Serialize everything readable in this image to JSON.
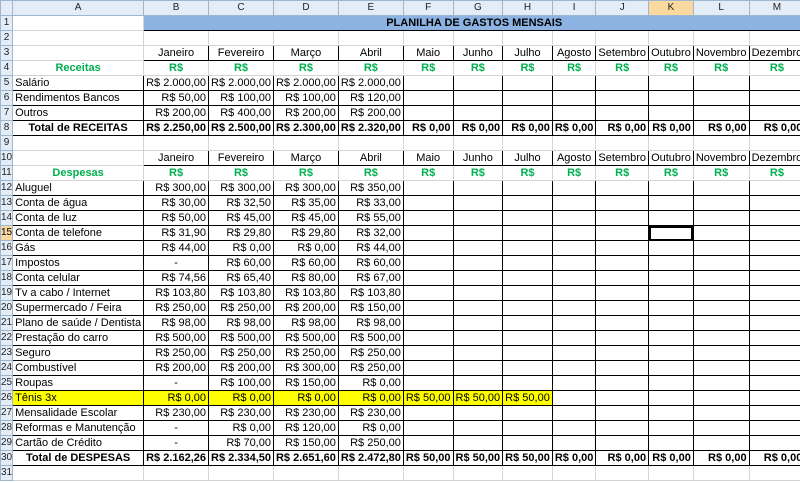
{
  "columns": [
    "",
    "A",
    "B",
    "C",
    "D",
    "E",
    "F",
    "G",
    "H",
    "I",
    "J",
    "K",
    "L",
    "M"
  ],
  "selected_column": "K",
  "selected_row": "15",
  "title": "PLANILHA DE GASTOS MENSAIS",
  "months": [
    "Janeiro",
    "Fevereiro",
    "Março",
    "Abril",
    "Maio",
    "Junho",
    "Julho",
    "Agosto",
    "Setembro",
    "Outubro",
    "Novembro",
    "Dezembro"
  ],
  "currency": "R$",
  "receitas_label": "Receitas",
  "despesas_label": "Despesas",
  "receitas": [
    {
      "row": "5",
      "label": "Salário",
      "values": [
        "R$ 2.000,00",
        "R$ 2.000,00",
        "R$ 2.000,00",
        "R$ 2.000,00",
        "",
        "",
        "",
        "",
        "",
        "",
        "",
        ""
      ]
    },
    {
      "row": "6",
      "label": "Rendimentos Bancos",
      "values": [
        "R$ 50,00",
        "R$ 100,00",
        "R$ 100,00",
        "R$ 120,00",
        "",
        "",
        "",
        "",
        "",
        "",
        "",
        ""
      ]
    },
    {
      "row": "7",
      "label": "Outros",
      "values": [
        "R$ 200,00",
        "R$ 400,00",
        "R$ 200,00",
        "R$ 200,00",
        "",
        "",
        "",
        "",
        "",
        "",
        "",
        ""
      ]
    }
  ],
  "total_receitas": {
    "row": "8",
    "label": "Total de RECEITAS",
    "values": [
      "R$ 2.250,00",
      "R$ 2.500,00",
      "R$ 2.300,00",
      "R$ 2.320,00",
      "R$ 0,00",
      "R$ 0,00",
      "R$ 0,00",
      "R$ 0,00",
      "R$ 0,00",
      "R$ 0,00",
      "R$ 0,00",
      "R$ 0,00"
    ]
  },
  "despesas": [
    {
      "row": "12",
      "label": "Aluguel",
      "values": [
        "R$ 300,00",
        "R$ 300,00",
        "R$ 300,00",
        "R$ 350,00",
        "",
        "",
        "",
        "",
        "",
        "",
        "",
        ""
      ]
    },
    {
      "row": "13",
      "label": "Conta de água",
      "values": [
        "R$ 30,00",
        "R$ 32,50",
        "R$ 35,00",
        "R$ 33,00",
        "",
        "",
        "",
        "",
        "",
        "",
        "",
        ""
      ]
    },
    {
      "row": "14",
      "label": "Conta de luz",
      "values": [
        "R$ 50,00",
        "R$ 45,00",
        "R$ 45,00",
        "R$ 55,00",
        "",
        "",
        "",
        "",
        "",
        "",
        "",
        ""
      ]
    },
    {
      "row": "15",
      "label": "Conta de telefone",
      "values": [
        "R$ 31,90",
        "R$ 29,80",
        "R$ 29,80",
        "R$ 32,00",
        "",
        "",
        "",
        "",
        "",
        "",
        "",
        ""
      ]
    },
    {
      "row": "16",
      "label": "Gás",
      "values": [
        "R$ 44,00",
        "R$ 0,00",
        "R$ 0,00",
        "R$ 44,00",
        "",
        "",
        "",
        "",
        "",
        "",
        "",
        ""
      ]
    },
    {
      "row": "17",
      "label": "Impostos",
      "values": [
        "-",
        "R$ 60,00",
        "R$ 60,00",
        "R$ 60,00",
        "",
        "",
        "",
        "",
        "",
        "",
        "",
        ""
      ]
    },
    {
      "row": "18",
      "label": "Conta celular",
      "values": [
        "R$ 74,56",
        "R$ 65,40",
        "R$ 80,00",
        "R$ 67,00",
        "",
        "",
        "",
        "",
        "",
        "",
        "",
        ""
      ]
    },
    {
      "row": "19",
      "label": "Tv a cabo / Internet",
      "values": [
        "R$ 103,80",
        "R$ 103,80",
        "R$ 103,80",
        "R$ 103,80",
        "",
        "",
        "",
        "",
        "",
        "",
        "",
        ""
      ]
    },
    {
      "row": "20",
      "label": "Supermercado / Feira",
      "values": [
        "R$ 250,00",
        "R$ 250,00",
        "R$ 200,00",
        "R$ 150,00",
        "",
        "",
        "",
        "",
        "",
        "",
        "",
        ""
      ]
    },
    {
      "row": "21",
      "label": "Plano de saúde / Dentista",
      "values": [
        "R$ 98,00",
        "R$ 98,00",
        "R$ 98,00",
        "R$ 98,00",
        "",
        "",
        "",
        "",
        "",
        "",
        "",
        ""
      ]
    },
    {
      "row": "22",
      "label": "Prestação do carro",
      "values": [
        "R$ 500,00",
        "R$ 500,00",
        "R$ 500,00",
        "R$ 500,00",
        "",
        "",
        "",
        "",
        "",
        "",
        "",
        ""
      ]
    },
    {
      "row": "23",
      "label": "Seguro",
      "values": [
        "R$ 250,00",
        "R$ 250,00",
        "R$ 250,00",
        "R$ 250,00",
        "",
        "",
        "",
        "",
        "",
        "",
        "",
        ""
      ]
    },
    {
      "row": "24",
      "label": "Combustível",
      "values": [
        "R$ 200,00",
        "R$ 200,00",
        "R$ 300,00",
        "R$ 250,00",
        "",
        "",
        "",
        "",
        "",
        "",
        "",
        ""
      ]
    },
    {
      "row": "25",
      "label": "Roupas",
      "values": [
        "-",
        "R$ 100,00",
        "R$ 150,00",
        "R$ 0,00",
        "",
        "",
        "",
        "",
        "",
        "",
        "",
        ""
      ]
    },
    {
      "row": "26",
      "label": "Tênis 3x",
      "highlight": true,
      "values": [
        "R$ 0,00",
        "R$ 0,00",
        "R$ 0,00",
        "R$ 0,00",
        "R$ 50,00",
        "R$ 50,00",
        "R$ 50,00",
        "",
        "",
        "",
        "",
        ""
      ]
    },
    {
      "row": "27",
      "label": "Mensalidade Escolar",
      "values": [
        "R$ 230,00",
        "R$ 230,00",
        "R$ 230,00",
        "R$ 230,00",
        "",
        "",
        "",
        "",
        "",
        "",
        "",
        ""
      ]
    },
    {
      "row": "28",
      "label": "Reformas e Manutenção",
      "values": [
        "-",
        "R$ 0,00",
        "R$ 120,00",
        "R$ 0,00",
        "",
        "",
        "",
        "",
        "",
        "",
        "",
        ""
      ]
    },
    {
      "row": "29",
      "label": "Cartão de Crédito",
      "values": [
        "-",
        "R$ 70,00",
        "R$ 150,00",
        "R$ 250,00",
        "",
        "",
        "",
        "",
        "",
        "",
        "",
        ""
      ]
    }
  ],
  "total_despesas": {
    "row": "30",
    "label": "Total de DESPESAS",
    "values": [
      "R$ 2.162,26",
      "R$ 2.334,50",
      "R$ 2.651,60",
      "R$ 2.472,80",
      "R$ 50,00",
      "R$ 50,00",
      "R$ 50,00",
      "R$ 0,00",
      "R$ 0,00",
      "R$ 0,00",
      "R$ 0,00",
      "R$ 0,00"
    ]
  },
  "empty_rows": [
    "2",
    "9",
    "31"
  ],
  "header_rows": {
    "months_1": "3",
    "currency_1": "4",
    "months_2": "10",
    "currency_2": "11",
    "title": "1"
  }
}
